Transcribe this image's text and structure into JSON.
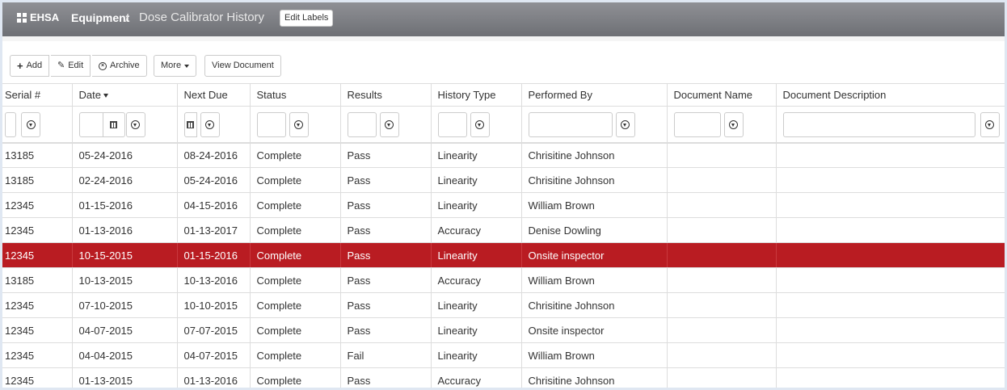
{
  "header": {
    "brand": "EHSA",
    "breadcrumb_equipment": "Equipment",
    "breadcrumb_separator": "/",
    "page_title": "Dose Calibrator History",
    "edit_labels": "Edit Labels"
  },
  "toolbar": {
    "add": "Add",
    "edit": "Edit",
    "archive": "Archive",
    "more": "More",
    "view_document": "View Document"
  },
  "columns": [
    "Serial #",
    "Date",
    "Next Due",
    "Status",
    "Results",
    "History Type",
    "Performed By",
    "Document Name",
    "Document Description"
  ],
  "rows": [
    {
      "serial": "13185",
      "date": "05-24-2016",
      "next_due": "08-24-2016",
      "status": "Complete",
      "results": "Pass",
      "history_type": "Linearity",
      "performed_by": "Chrisitine Johnson",
      "doc_name": "",
      "doc_desc": ""
    },
    {
      "serial": "13185",
      "date": "02-24-2016",
      "next_due": "05-24-2016",
      "status": "Complete",
      "results": "Pass",
      "history_type": "Linearity",
      "performed_by": "Chrisitine Johnson",
      "doc_name": "",
      "doc_desc": ""
    },
    {
      "serial": "12345",
      "date": "01-15-2016",
      "next_due": "04-15-2016",
      "status": "Complete",
      "results": "Pass",
      "history_type": "Linearity",
      "performed_by": "William Brown",
      "doc_name": "",
      "doc_desc": ""
    },
    {
      "serial": "12345",
      "date": "01-13-2016",
      "next_due": "01-13-2017",
      "status": "Complete",
      "results": "Pass",
      "history_type": "Accuracy",
      "performed_by": "Denise Dowling",
      "doc_name": "",
      "doc_desc": ""
    },
    {
      "serial": "12345",
      "date": "10-15-2015",
      "next_due": "01-15-2016",
      "status": "Complete",
      "results": "Pass",
      "history_type": "Linearity",
      "performed_by": "Onsite inspector",
      "doc_name": "",
      "doc_desc": ""
    },
    {
      "serial": "13185",
      "date": "10-13-2015",
      "next_due": "10-13-2016",
      "status": "Complete",
      "results": "Pass",
      "history_type": "Accuracy",
      "performed_by": "William Brown",
      "doc_name": "",
      "doc_desc": ""
    },
    {
      "serial": "12345",
      "date": "07-10-2015",
      "next_due": "10-10-2015",
      "status": "Complete",
      "results": "Pass",
      "history_type": "Linearity",
      "performed_by": "Chrisitine Johnson",
      "doc_name": "",
      "doc_desc": ""
    },
    {
      "serial": "12345",
      "date": "04-07-2015",
      "next_due": "07-07-2015",
      "status": "Complete",
      "results": "Pass",
      "history_type": "Linearity",
      "performed_by": "Onsite inspector",
      "doc_name": "",
      "doc_desc": ""
    },
    {
      "serial": "12345",
      "date": "04-04-2015",
      "next_due": "04-07-2015",
      "status": "Complete",
      "results": "Fail",
      "history_type": "Linearity",
      "performed_by": "William Brown",
      "doc_name": "",
      "doc_desc": ""
    },
    {
      "serial": "12345",
      "date": "01-13-2015",
      "next_due": "01-13-2016",
      "status": "Complete",
      "results": "Pass",
      "history_type": "Accuracy",
      "performed_by": "Chrisitine Johnson",
      "doc_name": "",
      "doc_desc": ""
    }
  ],
  "selected_row": 4,
  "colors": {
    "selected_row_bg": "#b91c22",
    "header_bg": "#7f8085"
  }
}
